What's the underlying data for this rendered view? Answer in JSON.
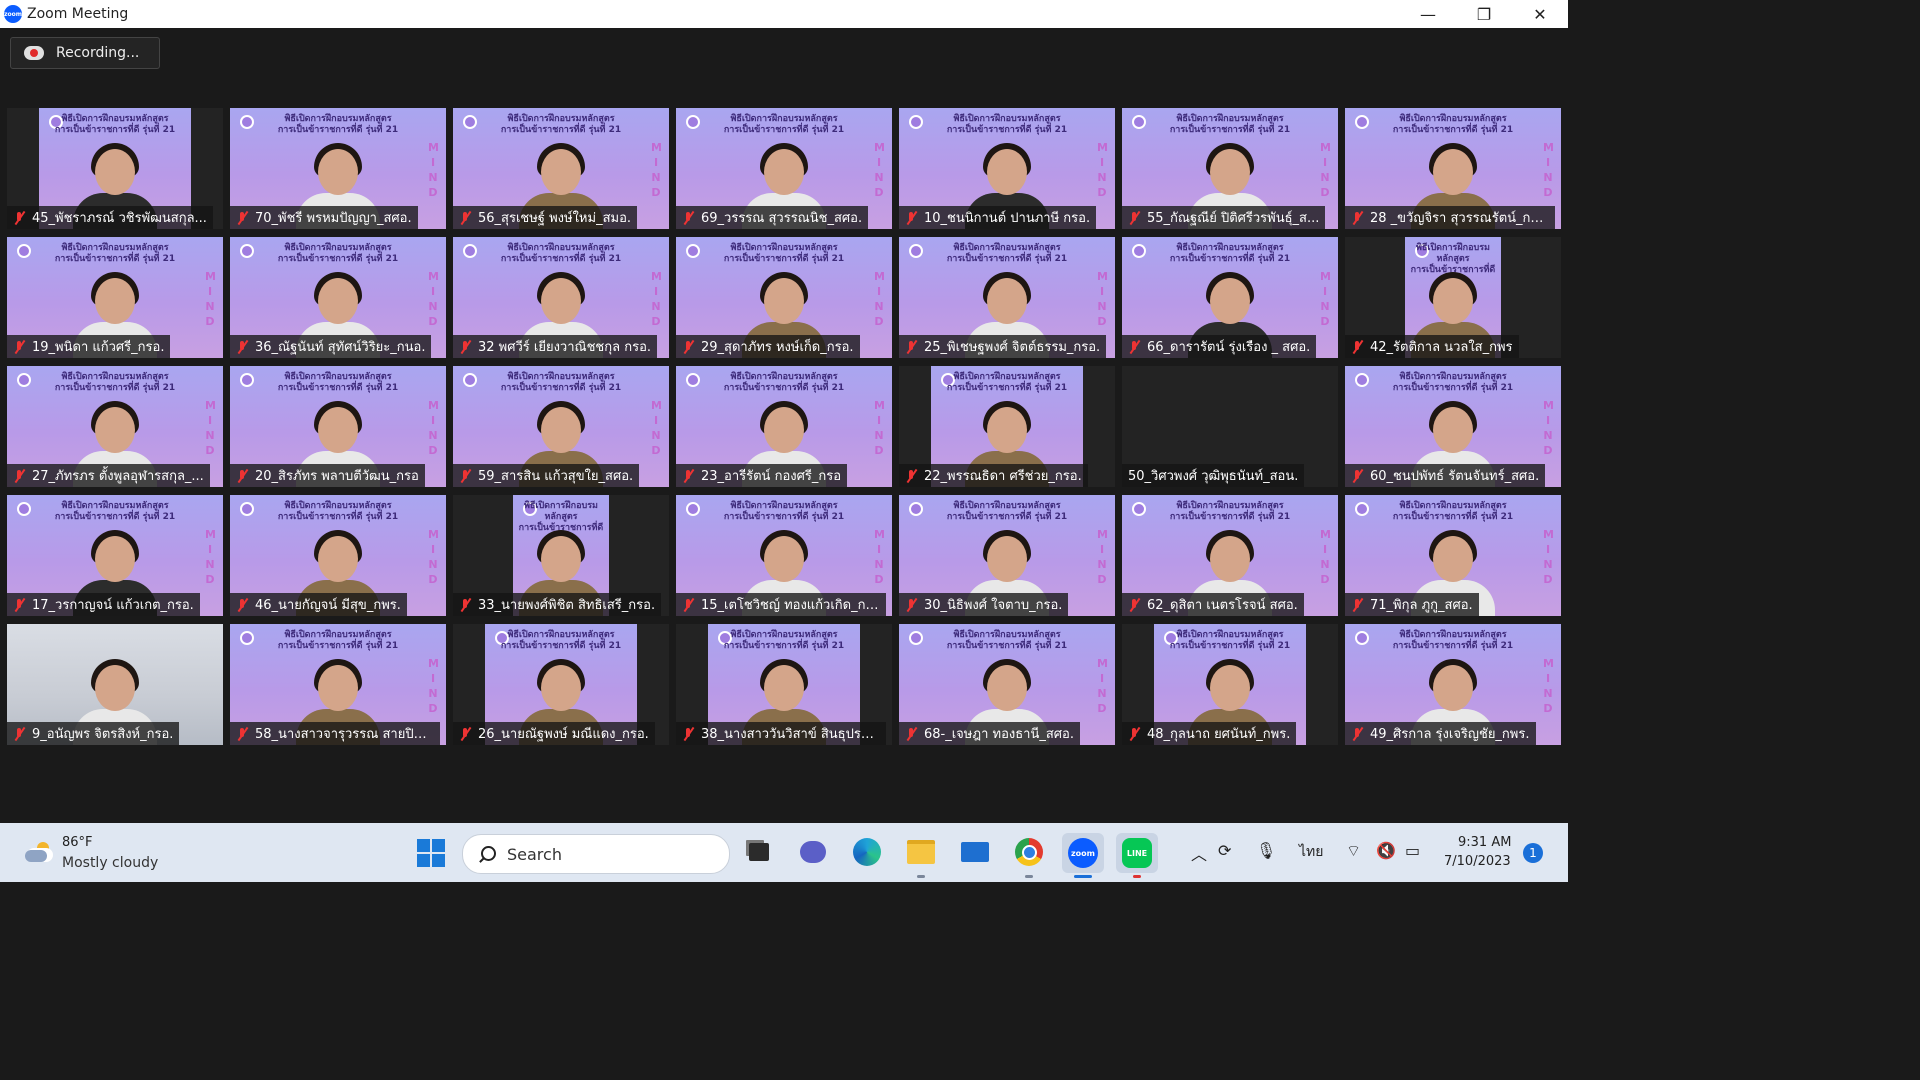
{
  "window": {
    "title": "Zoom Meeting",
    "minimize": "—",
    "restore": "❐",
    "close": "✕"
  },
  "recording": {
    "label": "Recording..."
  },
  "banner": {
    "line1": "พิธีเปิดการฝึกอบรมหลักสูตร",
    "line2": "การเป็นข้าราชการที่ดี รุ่นที่ 21"
  },
  "mind_letters": [
    "M",
    "I",
    "N",
    "D"
  ],
  "participants": [
    {
      "name": "45_พัชราภรณ์ วชิรพัฒนสกุล...",
      "bg": "narrow",
      "muted": true,
      "body": "dark"
    },
    {
      "name": "70_พัชรี พรหมปัญญา_สศอ.",
      "bg": "full",
      "muted": true,
      "body": "white"
    },
    {
      "name": "56_สุรเชษฐ์ พงษ์ใหม่_สมอ.",
      "bg": "full",
      "muted": true,
      "body": "brown"
    },
    {
      "name": "69_วรรรณ สุวรรณนิช_สศอ.",
      "bg": "full",
      "muted": true,
      "body": "white"
    },
    {
      "name": "10_ชนนิกานต์ ปานภาษี กรอ.",
      "bg": "full",
      "muted": true,
      "body": "dark"
    },
    {
      "name": "55_กัณฐณีย์ ปิติศรีวรพันธุ์_ส...",
      "bg": "full",
      "muted": true,
      "body": "white"
    },
    {
      "name": "28 _ขวัญจิรา สุวรรณรัตน์_กรอ.",
      "bg": "full",
      "muted": true,
      "body": "brown"
    },
    {
      "name": "19_พนิดา แก้วศรี_กรอ.",
      "bg": "full",
      "muted": true,
      "body": "white"
    },
    {
      "name": "36_ณัฐนันท์ สุทัศน์วิริยะ_กนอ.",
      "bg": "full",
      "muted": true,
      "body": "white"
    },
    {
      "name": "32 พศวีร์ เยียงวาณิชชกุล กรอ.",
      "bg": "full",
      "muted": true,
      "body": "white"
    },
    {
      "name": "29_สุดาภัทร หงษ์เก็ด_กรอ.",
      "bg": "full",
      "muted": true,
      "body": "brown"
    },
    {
      "name": "25_พิเชษฐพงศ์ จิตต์ธรรม_กรอ.",
      "bg": "full",
      "muted": true,
      "body": "white"
    },
    {
      "name": "66_ดารารัตน์ รุ่งเรือง _ สศอ.",
      "bg": "full",
      "muted": true,
      "body": "dark"
    },
    {
      "name": "42_รัตติกาล นวลใส_กพร",
      "bg": "small",
      "muted": true,
      "body": "brown"
    },
    {
      "name": "27_ภัทรภร ตั้งพูลอุฬารสกุล_...",
      "bg": "full",
      "muted": true,
      "body": "white"
    },
    {
      "name": "20_สิรภัทร พลาบตีวัฒน_กรอ",
      "bg": "full",
      "muted": true,
      "body": "white"
    },
    {
      "name": "59_สารสิน แก้วสุขใย_สศอ.",
      "bg": "full",
      "muted": true,
      "body": "brown"
    },
    {
      "name": "23_อารีรัตน์ กองศรี_กรอ",
      "bg": "full",
      "muted": true,
      "body": "white"
    },
    {
      "name": "22_พรรณธิดา ศรีช่วย_กรอ.",
      "bg": "narrow",
      "muted": true,
      "body": "brown"
    },
    {
      "name": "50_วิศวพงศ์ วุฒิพุธนันท์_สอน.",
      "bg": "none",
      "muted": false,
      "body": "none"
    },
    {
      "name": "60_ชนปพัทธ์ รัตนจันทร์_สศอ.",
      "bg": "full",
      "muted": true,
      "body": "white"
    },
    {
      "name": "17_วรกาญจน์ แก้วเกต_กรอ.",
      "bg": "full",
      "muted": true,
      "body": "dark"
    },
    {
      "name": "46_นายกัญจน์ มีสุข_กพร.",
      "bg": "full",
      "muted": true,
      "body": "brown"
    },
    {
      "name": "33_นายพงศ์พิชิต สิทธิเสรี_กรอ.",
      "bg": "small",
      "muted": true,
      "body": "brown"
    },
    {
      "name": "15_เตโชวิชญ์ ทองแก้วเกิด_กรอ.",
      "bg": "full",
      "muted": true,
      "body": "white"
    },
    {
      "name": "30_นิธิพงศ์ ใจตาบ_กรอ.",
      "bg": "full",
      "muted": true,
      "body": "white"
    },
    {
      "name": "62_ดุสิตา เนตรโรจน์ สศอ.",
      "bg": "full",
      "muted": true,
      "body": "white"
    },
    {
      "name": "71_พิกุล ภูกู_สศอ.",
      "bg": "full",
      "muted": true,
      "body": "white"
    },
    {
      "name": "9_อนัญพร จิตรสิงห์_กรอ.",
      "bg": "office",
      "muted": true,
      "body": "white"
    },
    {
      "name": "58_นางสาวจารุวรรณ สายปิน...",
      "bg": "full",
      "muted": true,
      "body": "brown"
    },
    {
      "name": "26_นายณัฐพงษ์ มณีแดง_กรอ.",
      "bg": "narrow",
      "muted": true,
      "body": "brown"
    },
    {
      "name": "38_นางสาววันวิสาข์ สินธุประสิ...",
      "bg": "narrow",
      "muted": true,
      "body": "brown"
    },
    {
      "name": "68-_เจษฎา ทองธานี_สศอ.",
      "bg": "full",
      "muted": true,
      "body": "white"
    },
    {
      "name": "48_กุลนาถ ยศนันท์_กพร.",
      "bg": "narrow",
      "muted": true,
      "body": "brown"
    },
    {
      "name": "49_ศิรกาล รุ่งเจริญชัย_กพร.",
      "bg": "full",
      "muted": true,
      "body": "white"
    }
  ],
  "taskbar": {
    "weather_temp": "86°F",
    "weather_desc": "Mostly cloudy",
    "search_label": "Search",
    "lang": "ไทย",
    "time": "9:31 AM",
    "date": "7/10/2023",
    "notifications": "1",
    "zoom_icon": "zoom",
    "line_icon": "LINE"
  }
}
